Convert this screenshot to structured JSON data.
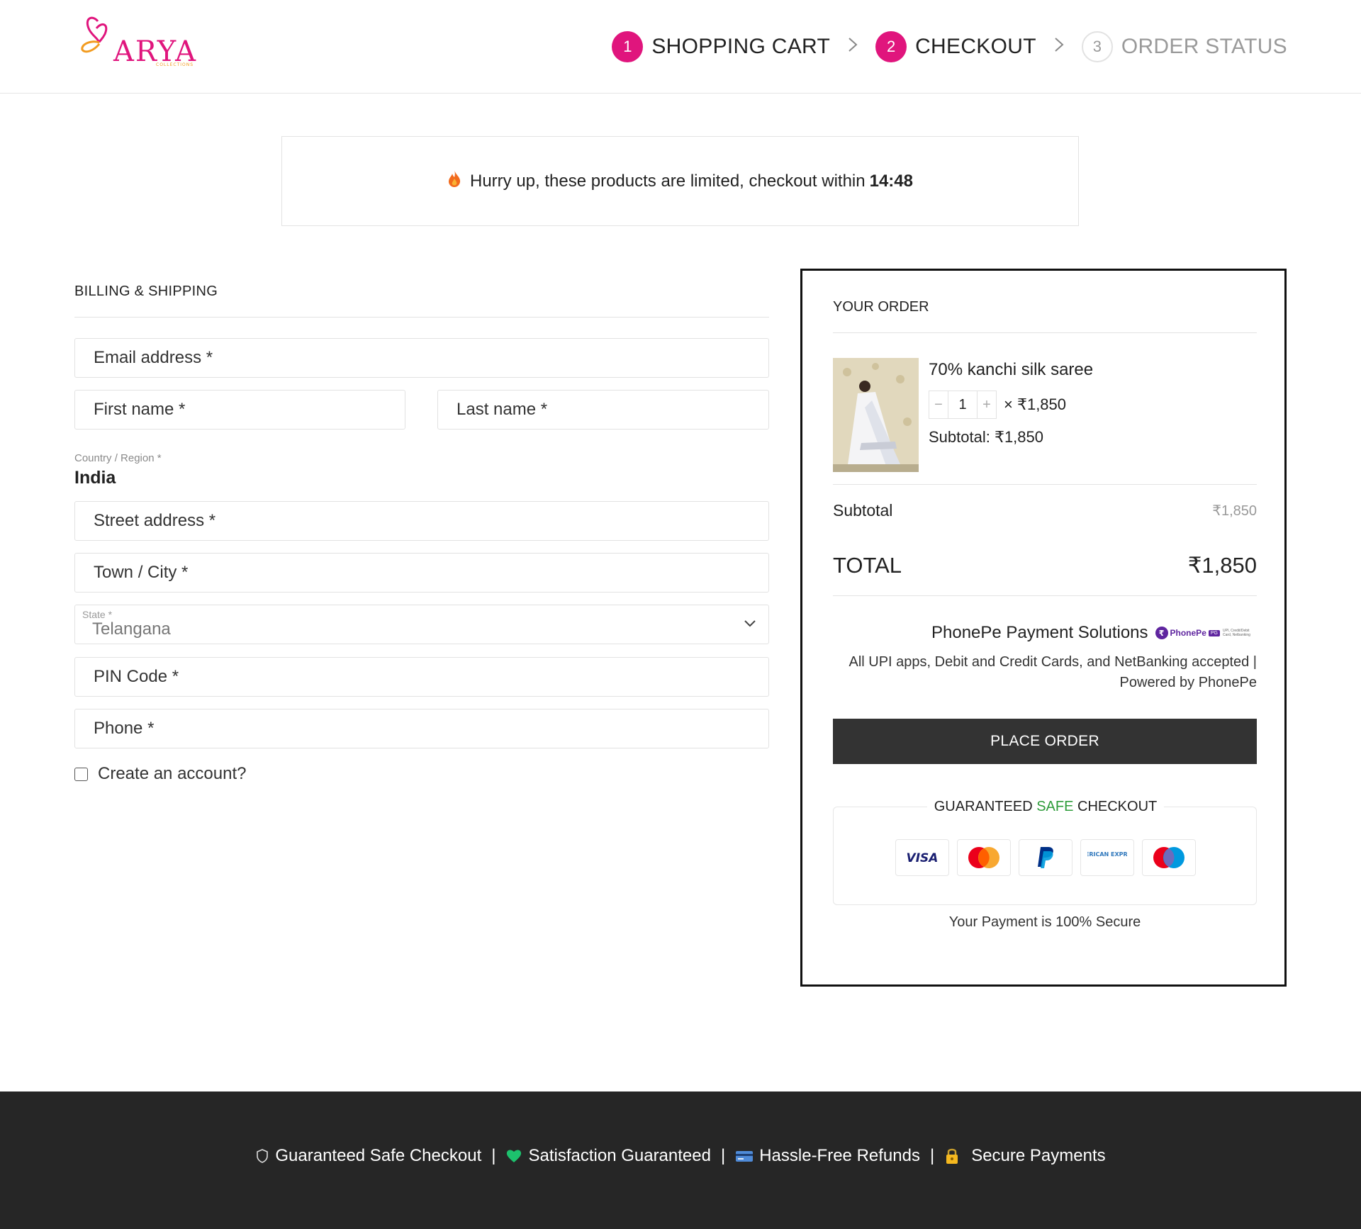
{
  "brand": {
    "name": "ARYA",
    "subtitle": "COLLECTIONS",
    "colors": {
      "primary": "#e0157d",
      "accent": "#f29b1f"
    }
  },
  "steps": [
    {
      "number": "1",
      "label": "SHOPPING CART",
      "active": true
    },
    {
      "number": "2",
      "label": "CHECKOUT",
      "active": true
    },
    {
      "number": "3",
      "label": "ORDER STATUS",
      "active": false
    }
  ],
  "step_separator_icon": "chevron-right-icon",
  "banner": {
    "icon": "flame-icon",
    "text": "Hurry up, these products are limited, checkout within",
    "timer": "14:48"
  },
  "billing": {
    "title": "BILLING & SHIPPING",
    "email_placeholder": "Email address *",
    "first_name_placeholder": "First name *",
    "last_name_placeholder": "Last name *",
    "country_label": "Country / Region *",
    "country_value": "India",
    "street_placeholder": "Street address *",
    "city_placeholder": "Town / City *",
    "state_label": "State *",
    "state_value": "Telangana",
    "pin_placeholder": "PIN Code *",
    "phone_placeholder": "Phone *",
    "create_account_label": "Create an account?"
  },
  "order": {
    "title": "YOUR ORDER",
    "product": {
      "name": "70% kanchi silk saree",
      "quantity": "1",
      "qty_minus": "−",
      "qty_plus": "+",
      "unit_price": "× ₹1,850",
      "subtotal": "Subtotal: ₹1,850"
    },
    "subtotal_label": "Subtotal",
    "subtotal_value": "₹1,850",
    "total_label": "TOTAL",
    "total_value": "₹1,850",
    "payment_method": "PhonePe Payment Solutions",
    "phonepe_logo_text": "PhonePe",
    "phonepe_tag": "PG",
    "phonepe_small": "UPI, Credit/Debit Card, Netbanking",
    "payment_desc": "All UPI apps, Debit and Credit Cards, and NetBanking accepted | Powered by PhonePe",
    "place_order": "PLACE ORDER",
    "guarantee_prefix": "GUARANTEED ",
    "guarantee_safe": "SAFE",
    "guarantee_suffix": " CHECKOUT",
    "cards": [
      "visa",
      "mastercard",
      "paypal",
      "american-express",
      "maestro"
    ],
    "card_texts": {
      "visa": "VISA",
      "amex": "AMERICAN EXPRESS"
    },
    "secure_note": "Your Payment is 100% Secure"
  },
  "footer": {
    "items": [
      {
        "icon": "shield-icon",
        "label": "Guaranteed Safe Checkout"
      },
      {
        "icon": "heart-icon",
        "label": "Satisfaction Guaranteed"
      },
      {
        "icon": "credit-card-icon",
        "label": "Hassle-Free Refunds"
      },
      {
        "icon": "lock-icon",
        "label": "Secure Payments"
      }
    ],
    "separator": "|"
  }
}
